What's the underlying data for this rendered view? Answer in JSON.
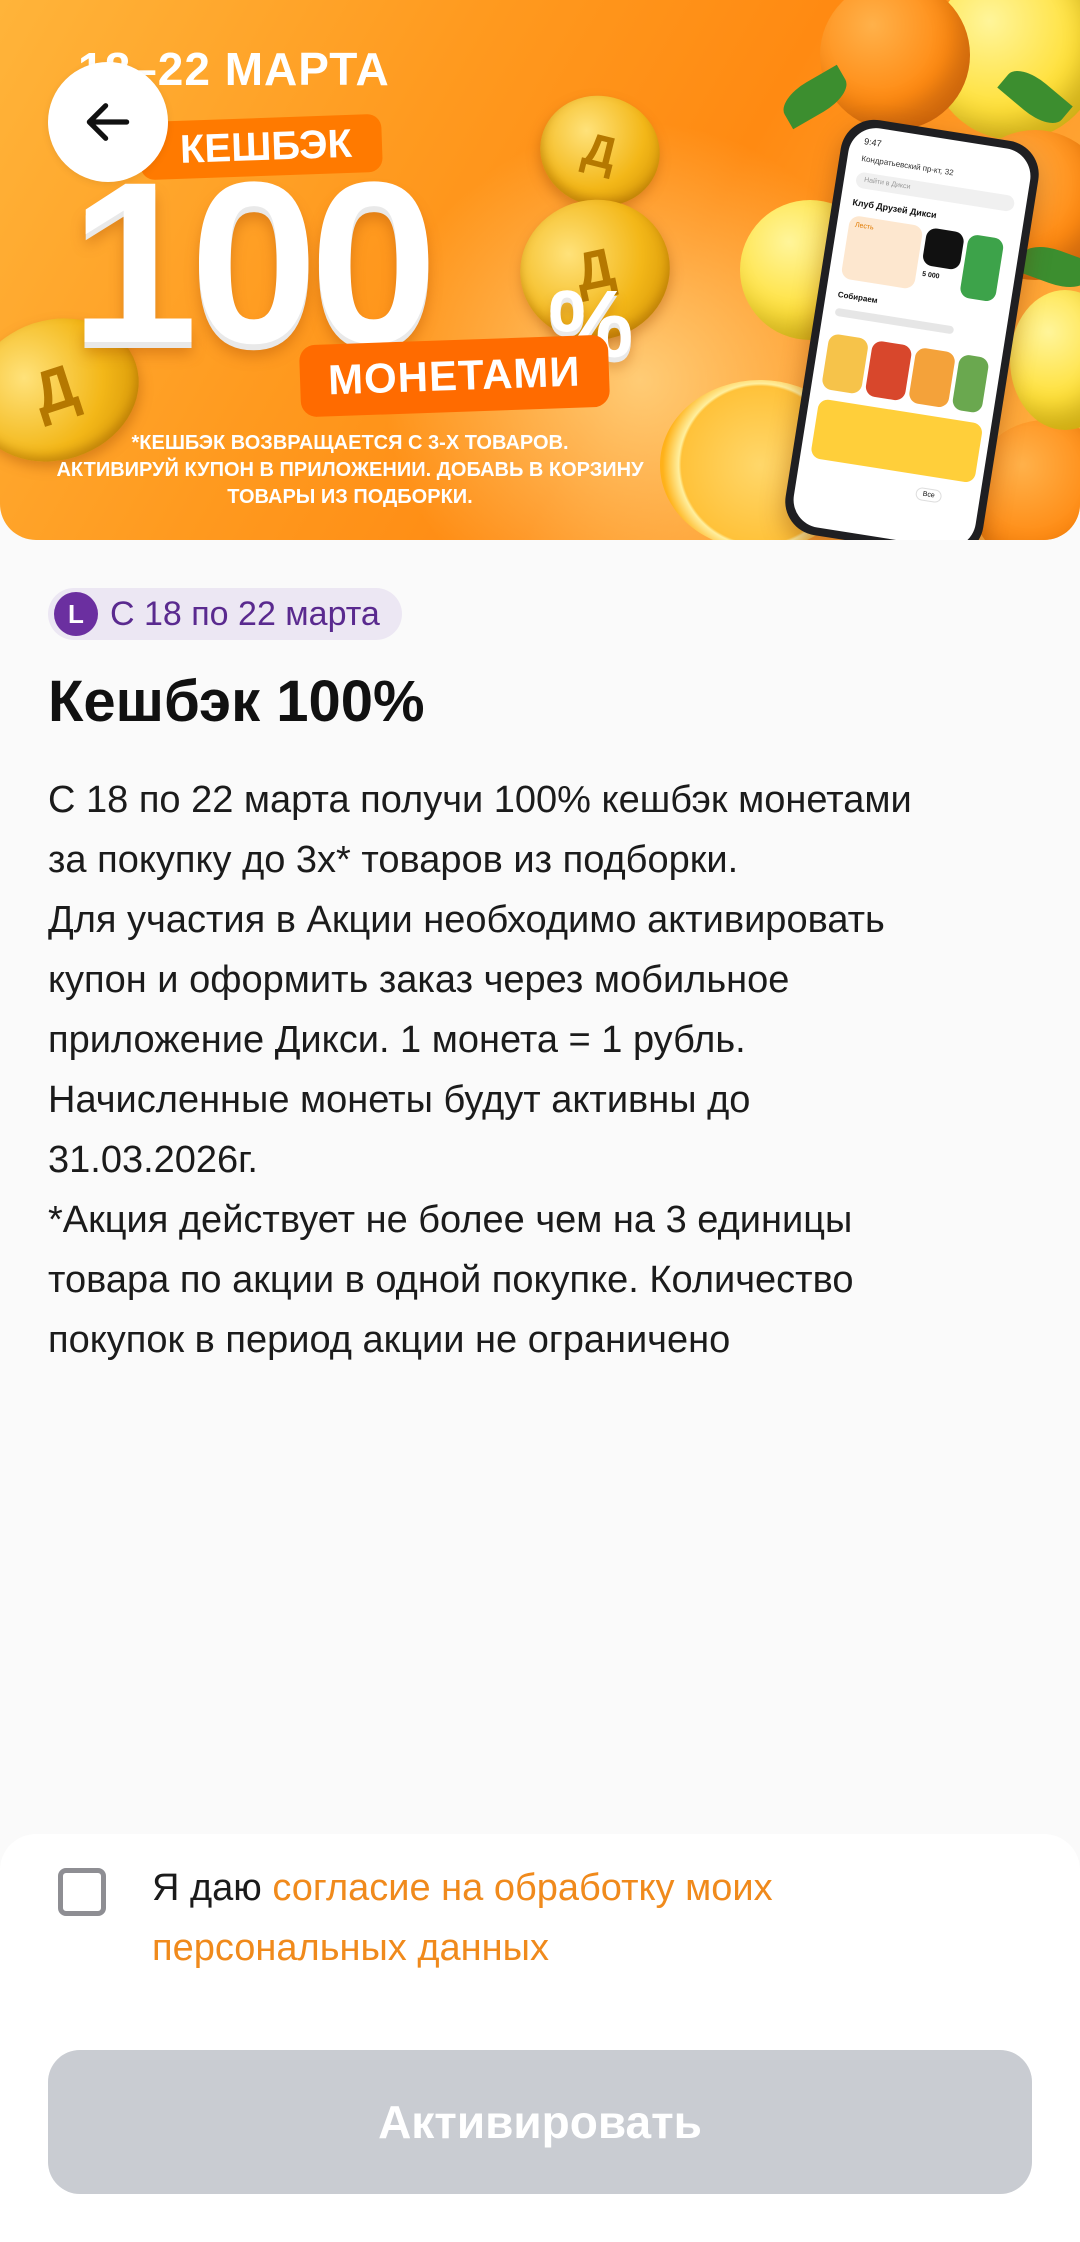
{
  "banner": {
    "date_range": "18–22 МАРТА",
    "cashback_label": "КЕШБЭК",
    "big_number": "100",
    "percent_sign": "%",
    "coins_label": "МОНЕТАМИ",
    "fine_print": "*КЕШБЭК ВОЗВРАЩАЕТСЯ С 3-Х ТОВАРОВ.\nАКТИВИРУЙ КУПОН В ПРИЛОЖЕНИИ. ДОБАВЬ В КОРЗИНУ\nТОВАРЫ ИЗ ПОДБОРКИ.",
    "coin_symbol": "Д",
    "phone": {
      "time": "9:47",
      "address": "Кондратьевский пр-кт, 32",
      "search": "Найти в Дикси",
      "club_title": "Клуб Друзей Дикси",
      "level": "Лесть",
      "balance": "5 000",
      "collections": "Собираем",
      "all_button": "Все"
    }
  },
  "back_button": {
    "icon": "arrow-left-icon"
  },
  "promo": {
    "chip_badge": "L",
    "chip_text": "С 18 по 22 марта",
    "title": "Кешбэк 100%",
    "description": "С 18 по 22 марта получи 100% кешбэк монетами\nза покупку до 3х* товаров из подборки.\nДля участия в Акции необходимо активировать\nкупон и оформить заказ через мобильное\nприложение Дикси. 1 монета = 1 рубль.\nНачисленные монеты будут активны до\n31.03.2026г.\n*Акция действует не более чем на 3 единицы\nтовара по акции в одной покупке. Количество\nпокупок в период акции не ограничено"
  },
  "consent": {
    "prefix": "Я даю ",
    "link": "согласие на обработку моих персональных данных",
    "checked": false
  },
  "activate_button": {
    "label": "Активировать"
  },
  "colors": {
    "accent_orange": "#f08a1c",
    "chip_purple": "#6b2fa0",
    "button_disabled": "#c9ccd2"
  }
}
